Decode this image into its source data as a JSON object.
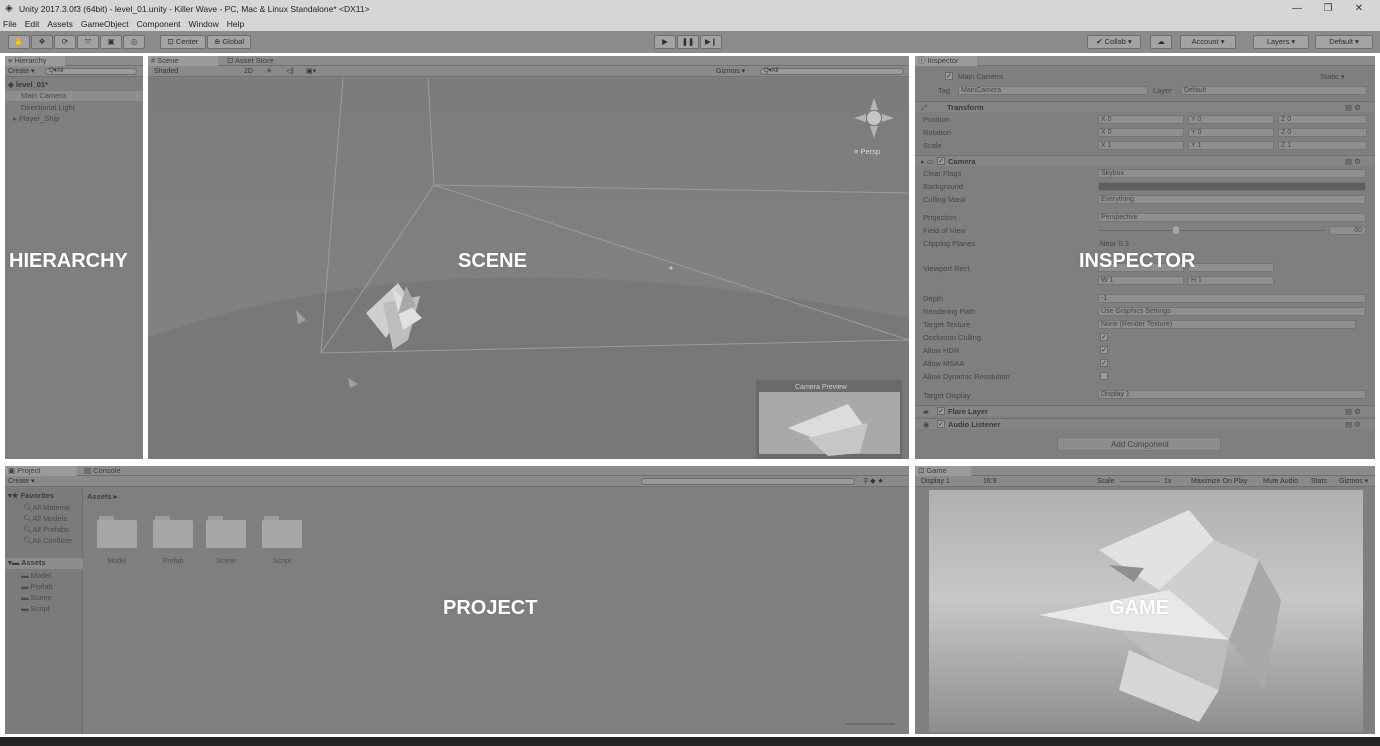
{
  "window": {
    "title": "Unity 2017.3.0f3 (64bit) - level_01.unity - Killer Wave - PC, Mac & Linux Standalone* <DX11>",
    "minimize": "—",
    "maximize": "❐",
    "close": "✕"
  },
  "menu": [
    "File",
    "Edit",
    "Assets",
    "GameObject",
    "Component",
    "Window",
    "Help"
  ],
  "toolbar": {
    "pivot": "Center",
    "space": "Global",
    "collab": "Collab ▾",
    "account": "Account",
    "layers": "Layers",
    "layout": "Default"
  },
  "hierarchy": {
    "tab": "Hierarchy",
    "create": "Create ▾",
    "search_placeholder": "Q▾All",
    "scene_name": "level_01*",
    "items": [
      "Main Camera",
      "Directional Light",
      "Player_Ship"
    ],
    "overlay": "HIERARCHY"
  },
  "scene": {
    "tabs": [
      "Scene",
      "Asset Store"
    ],
    "shading": "Shaded",
    "mode_2d": "2D",
    "gizmos": "Gizmos ▾",
    "search": "Q▾All",
    "persp": "≡ Persp",
    "camera_preview": "Camera Preview",
    "overlay": "SCENE"
  },
  "inspector": {
    "tab": "Inspector",
    "object_name": "Main Camera",
    "static": "Static ▾",
    "tag_label": "Tag",
    "tag_value": "MainCamera",
    "layer_label": "Layer",
    "layer_value": "Default",
    "transform": {
      "title": "Transform",
      "position_label": "Position",
      "rotation_label": "Rotation",
      "scale_label": "Scale",
      "position": [
        "X 0",
        "Y 0",
        "Z 0"
      ],
      "rotation": [
        "X 0",
        "Y 0",
        "Z 0"
      ],
      "scale": [
        "X 1",
        "Y 1",
        "Z 1"
      ]
    },
    "camera": {
      "title": "Camera",
      "rows": [
        {
          "label": "Clear Flags",
          "value": "Skybox"
        },
        {
          "label": "Background",
          "value": ""
        },
        {
          "label": "Culling Mask",
          "value": "Everything"
        },
        {
          "label": "Projection",
          "value": "Perspective"
        },
        {
          "label": "Field of View",
          "value": "60"
        },
        {
          "label": "Clipping Planes",
          "value": "Near  0.3"
        },
        {
          "label": "Viewport Rect",
          "value": ""
        },
        {
          "label": "W",
          "value": "W 1"
        },
        {
          "label": "H",
          "value": "H 1"
        },
        {
          "label": "Depth",
          "value": "-1"
        },
        {
          "label": "Rendering Path",
          "value": "Use Graphics Settings"
        },
        {
          "label": "Target Texture",
          "value": "None (Render Texture)"
        },
        {
          "label": "Occlusion Culling",
          "value": "✓"
        },
        {
          "label": "Allow HDR",
          "value": "✓"
        },
        {
          "label": "Allow MSAA",
          "value": "✓"
        },
        {
          "label": "Allow Dynamic Resolution",
          "value": ""
        },
        {
          "label": "Target Display",
          "value": "Display 1"
        }
      ]
    },
    "flare_layer": "Flare Layer",
    "audio_listener": "Audio Listener",
    "add_component": "Add Component",
    "overlay": "INSPECTOR"
  },
  "project": {
    "tabs": [
      "Project",
      "Console"
    ],
    "create": "Create ▾",
    "favorites_title": "Favorites",
    "favorites": [
      "All Material",
      "All Models",
      "All Prefabs",
      "All Conflicte"
    ],
    "assets_title": "Assets",
    "asset_folders": [
      "Model",
      "Prefab",
      "Scene",
      "Script"
    ],
    "breadcrumb": "Assets ▸",
    "grid_folders": [
      "Model",
      "Prefab",
      "Scene",
      "Script"
    ],
    "overlay": "PROJECT"
  },
  "game": {
    "tab": "Game",
    "display": "Display 1",
    "aspect": "16:9",
    "scale_label": "Scale",
    "scale_value": "1x",
    "maximize": "Maximize On Play",
    "mute": "Mute Audio",
    "stats": "Stats",
    "gizmos": "Gizmos ▾",
    "overlay": "GAME"
  }
}
